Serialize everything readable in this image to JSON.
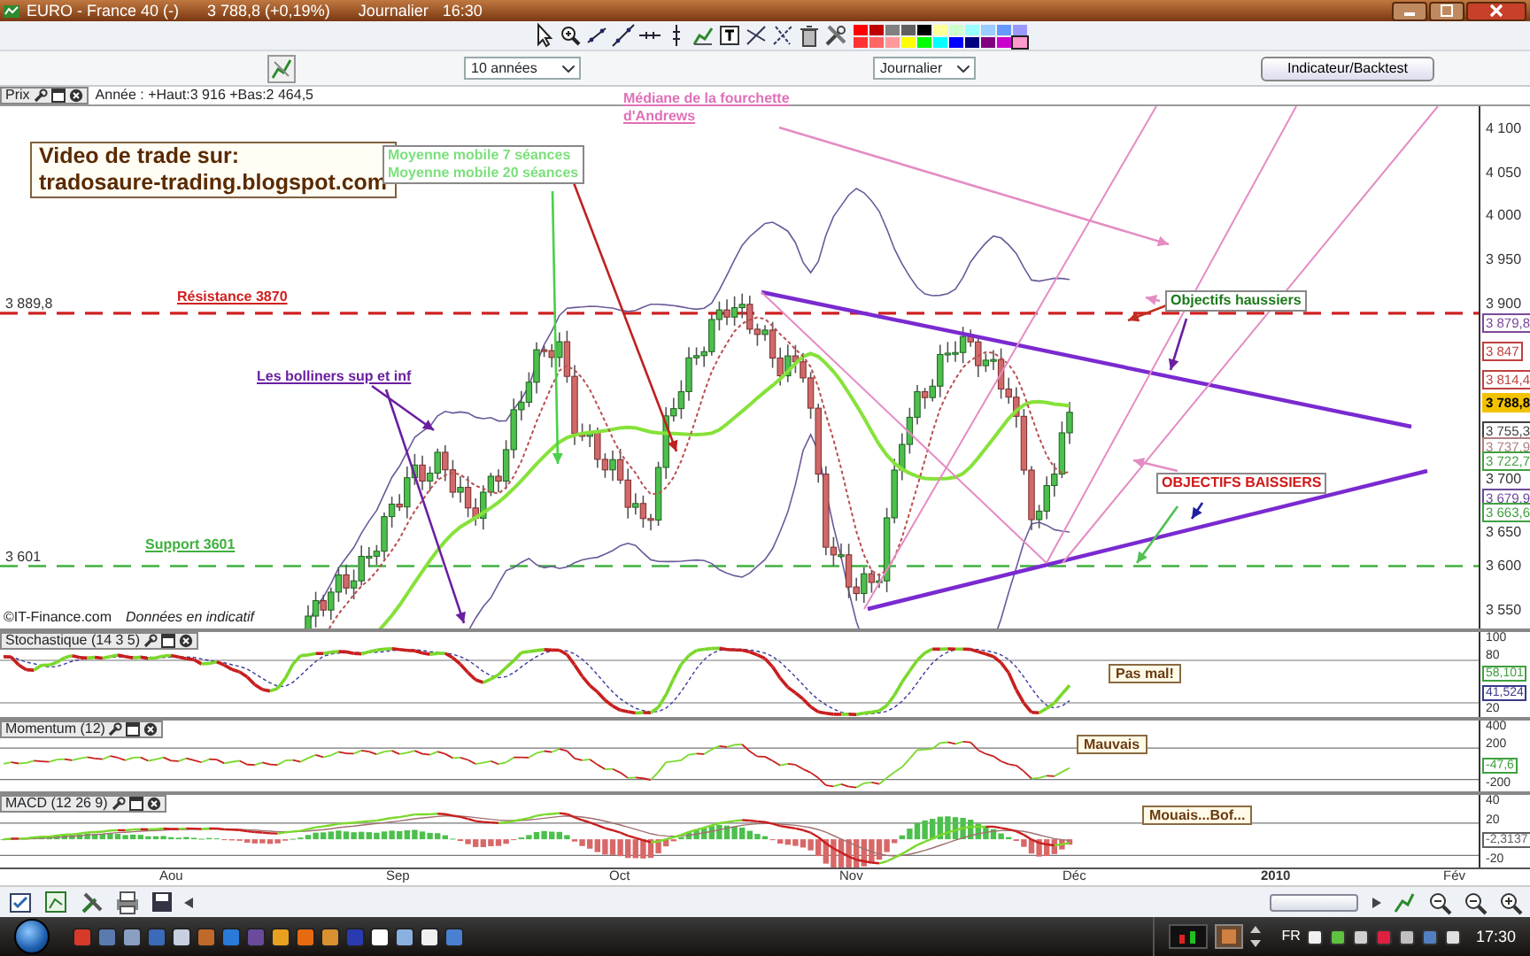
{
  "window": {
    "title": "EURO - France 40 (-)",
    "quote": "3 788,8 (+0,19%)",
    "period": "Journalier",
    "time": "16:30"
  },
  "palette": [
    {
      "color": "#ff0000",
      "selected": false
    },
    {
      "color": "#c00000",
      "selected": false
    },
    {
      "color": "#808080",
      "selected": false
    },
    {
      "color": "#606060",
      "selected": false
    },
    {
      "color": "#000000",
      "selected": false
    },
    {
      "color": "#ffff99",
      "selected": false
    },
    {
      "color": "#ccffcc",
      "selected": false
    },
    {
      "color": "#99ffff",
      "selected": false
    },
    {
      "color": "#99ccff",
      "selected": false
    },
    {
      "color": "#6699ff",
      "selected": false
    },
    {
      "color": "#9999ff",
      "selected": false
    },
    {
      "color": "#ff3333",
      "selected": false
    },
    {
      "color": "#ff6666",
      "selected": false
    },
    {
      "color": "#ff9999",
      "selected": false
    },
    {
      "color": "#ffff00",
      "selected": false
    },
    {
      "color": "#00ff00",
      "selected": false
    },
    {
      "color": "#00ffff",
      "selected": false
    },
    {
      "color": "#0000ff",
      "selected": false
    },
    {
      "color": "#000080",
      "selected": false
    },
    {
      "color": "#800080",
      "selected": false
    },
    {
      "color": "#cc00cc",
      "selected": false
    },
    {
      "color": "#ff99cc",
      "selected": true
    }
  ],
  "toolbar": {
    "range_select": "10 années",
    "interval_select": "Journalier",
    "indicator_button": "Indicateur/Backtest"
  },
  "price_panel": {
    "title": "Prix",
    "summary": "Année : +Haut:3 916 +Bas:2 464,5",
    "banner": [
      "Video de trade sur:",
      "tradosaure-trading.blogspot.com"
    ],
    "level_labels": [
      {
        "text": "3 889,8",
        "kind": "resistance"
      },
      {
        "text": "3 601",
        "kind": "support"
      }
    ],
    "annotations": [
      {
        "kind": "underlined",
        "color": "#e070b8",
        "lines": [
          "Médiane de la fourchette",
          "d'Andrews"
        ]
      },
      {
        "kind": "boxed",
        "color": "#7ce07c",
        "lines": [
          "Moyenne mobile 7 séances",
          "Moyenne mobile 20 séances"
        ]
      },
      {
        "kind": "underlined",
        "color": "#d02020",
        "lines": [
          "Résistance 3870"
        ]
      },
      {
        "kind": "underlined",
        "color": "#6a1fa0",
        "lines": [
          "Les bolliners sup et inf"
        ]
      },
      {
        "kind": "underlined",
        "color": "#40b040",
        "lines": [
          "Support 3601"
        ]
      },
      {
        "kind": "boxed",
        "color": "#1c7a1c",
        "lines": [
          "Objectifs haussiers"
        ]
      },
      {
        "kind": "boxed",
        "color": "#d01818",
        "lines": [
          "OBJECTIFS BAISSIERS"
        ]
      }
    ],
    "credit": [
      "©IT-Finance.com",
      "Données en indicatif"
    ],
    "axis_ticks": [
      "4 100",
      "4 050",
      "4 000",
      "3 950",
      "3 900",
      "3 700",
      "3 650",
      "3 600",
      "3 550"
    ],
    "price_tags": [
      {
        "text": "3 879,8",
        "kind": "line",
        "color": "#7a4a9a"
      },
      {
        "text": "3 847",
        "kind": "line",
        "color": "#c04040"
      },
      {
        "text": "3 814,4",
        "kind": "line",
        "color": "#c04040"
      },
      {
        "text": "3 788,8",
        "kind": "current",
        "color": "#f2c200"
      },
      {
        "text": "3 755,3",
        "kind": "line",
        "color": "#404040"
      },
      {
        "text": "3 737,9",
        "kind": "line",
        "color": "#b08080"
      },
      {
        "text": "3 722,7",
        "kind": "line",
        "color": "#40a040"
      },
      {
        "text": "3 679,9",
        "kind": "line",
        "color": "#6a4a9a"
      },
      {
        "text": "3 663,6",
        "kind": "line",
        "color": "#40a040"
      }
    ]
  },
  "indicators": [
    {
      "kind": "stochastic",
      "title": "Stochastique (14 3 5)",
      "note": "Pas mal!",
      "ticks": [
        "100",
        "80",
        "20"
      ],
      "tags": [
        {
          "text": "58,101",
          "color": "#40a040"
        },
        {
          "text": "41,524",
          "color": "#3a3a8a"
        }
      ]
    },
    {
      "kind": "momentum",
      "title": "Momentum (12)",
      "note": "Mauvais",
      "ticks": [
        "400",
        "200",
        "-200"
      ],
      "tags": [
        {
          "text": "-47,6",
          "color": "#40a040"
        }
      ]
    },
    {
      "kind": "macd",
      "title": "MACD (12 26 9)",
      "note": "Mouais...Bof...",
      "ticks": [
        "40",
        "20",
        "-20"
      ],
      "tags": [
        {
          "text": "-2,3137",
          "color": "#606060"
        }
      ]
    }
  ],
  "date_axis": [
    "Aou",
    "Sep",
    "Oct",
    "Nov",
    "Déc",
    "2010",
    "Fév"
  ],
  "taskbar": {
    "language": "FR",
    "clock": "17:30"
  }
}
